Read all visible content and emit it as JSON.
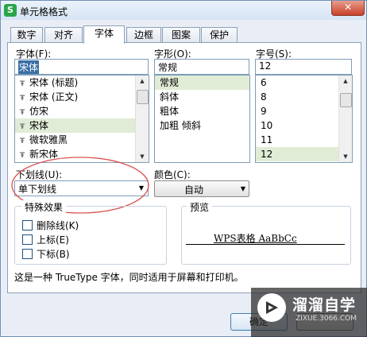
{
  "window": {
    "title": "单元格格式",
    "app_icon_letter": "S",
    "close_glyph": "✕"
  },
  "tabs": [
    {
      "label": "数字"
    },
    {
      "label": "对齐"
    },
    {
      "label": "字体"
    },
    {
      "label": "边框"
    },
    {
      "label": "图案"
    },
    {
      "label": "保护"
    }
  ],
  "active_tab": "字体",
  "font": {
    "label": "字体(F):",
    "value": "宋体",
    "items": [
      "宋体 (标题)",
      "宋体 (正文)",
      "仿宋",
      "宋体",
      "微软雅黑",
      "新宋体"
    ],
    "selected": "宋体"
  },
  "style": {
    "label": "字形(O):",
    "value": "常规",
    "items": [
      "常规",
      "斜体",
      "粗体",
      "加粗 倾斜"
    ],
    "selected": "常规"
  },
  "size": {
    "label": "字号(S):",
    "value": "12",
    "items": [
      "6",
      "8",
      "9",
      "10",
      "11",
      "12"
    ],
    "selected": "12"
  },
  "underline": {
    "label": "下划线(U):",
    "value": "单下划线",
    "annotation_color": "#d9534f"
  },
  "color": {
    "label": "颜色(C):",
    "value": "自动"
  },
  "effects": {
    "title": "特殊效果",
    "options": [
      {
        "label": "删除线(K)",
        "checked": false
      },
      {
        "label": "上标(E)",
        "checked": false
      },
      {
        "label": "下标(B)",
        "checked": false
      }
    ]
  },
  "preview": {
    "title": "预览",
    "text": "WPS表格  AaBbCc"
  },
  "info_text": "这是一种 TrueType 字体，同时适用于屏幕和打印机。",
  "buttons": {
    "ok": "确定"
  },
  "watermark": {
    "main": "溜溜自学",
    "sub": "ZIXUE.3066.COM"
  },
  "colors": {
    "selection": "#e1ecd6",
    "highlight": "#3a6ea5",
    "close": "#c8402a"
  }
}
